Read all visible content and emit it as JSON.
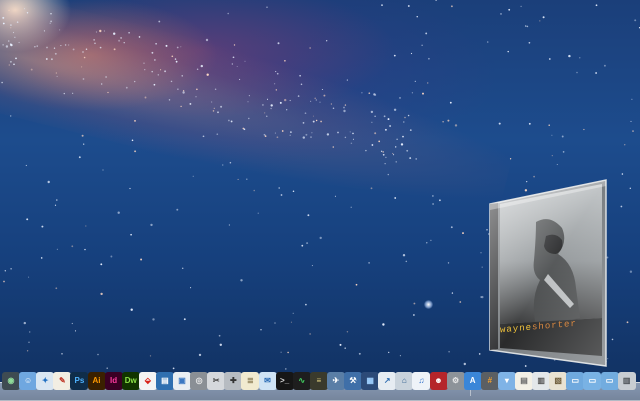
{
  "desktop": {
    "wallpaper": "Andromeda galaxy",
    "colors": {
      "sky": "#1d4c8d",
      "galaxy_core": "#ffe8cf",
      "accent": "#f0c23a"
    }
  },
  "cd_cover": {
    "artist_first": "wayne",
    "artist_last": "shorter"
  },
  "dock": {
    "items": [
      {
        "name": "time-machine-icon",
        "glyph": "◉",
        "bg": "#3e4b52",
        "fg": "#8fdc9a"
      },
      {
        "name": "finder-icon",
        "glyph": "☺",
        "bg": "#6fa7e0",
        "fg": "#ffffff"
      },
      {
        "name": "safari-icon",
        "glyph": "✦",
        "bg": "#d9e6f2",
        "fg": "#1f6fc2"
      },
      {
        "name": "textedit-icon",
        "glyph": "✎",
        "bg": "#f2eee3",
        "fg": "#c0392b"
      },
      {
        "name": "photoshop-icon",
        "glyph": "Ps",
        "bg": "#0f2d4a",
        "fg": "#4fb3ff"
      },
      {
        "name": "illustrator-icon",
        "glyph": "Ai",
        "bg": "#3a2000",
        "fg": "#ff9a00"
      },
      {
        "name": "indesign-icon",
        "glyph": "Id",
        "bg": "#3a0024",
        "fg": "#ff3ba0"
      },
      {
        "name": "dreamweaver-icon",
        "glyph": "Dw",
        "bg": "#113400",
        "fg": "#8de348"
      },
      {
        "name": "acrobat-icon",
        "glyph": "⬙",
        "bg": "#f4f4f4",
        "fg": "#d8231a"
      },
      {
        "name": "keynote-icon",
        "glyph": "▤",
        "bg": "#2f6fb0",
        "fg": "#ffffff"
      },
      {
        "name": "preview-icon",
        "glyph": "▣",
        "bg": "#e9eef2",
        "fg": "#3b78c2"
      },
      {
        "name": "dvd-player-icon",
        "glyph": "◎",
        "bg": "#8a8f95",
        "fg": "#e8e8e8"
      },
      {
        "name": "script-editor-icon",
        "glyph": "✂",
        "bg": "#d5d8dc",
        "fg": "#444444"
      },
      {
        "name": "disk-utility-icon",
        "glyph": "✚",
        "bg": "#b7bcc2",
        "fg": "#333333"
      },
      {
        "name": "notes-icon",
        "glyph": "≣",
        "bg": "#f1ead0",
        "fg": "#7a6a40"
      },
      {
        "name": "mail-icon",
        "glyph": "✉",
        "bg": "#cfe3f5",
        "fg": "#2a6bb5"
      },
      {
        "name": "terminal-icon",
        "glyph": ">_",
        "bg": "#161616",
        "fg": "#dcdcdc"
      },
      {
        "name": "activity-monitor-icon",
        "glyph": "∿",
        "bg": "#1e1e1e",
        "fg": "#40d060"
      },
      {
        "name": "console-icon",
        "glyph": "≡",
        "bg": "#3a3a2c",
        "fg": "#e0d080"
      },
      {
        "name": "automator-icon",
        "glyph": "✈",
        "bg": "#5a7ea6",
        "fg": "#ffffff"
      },
      {
        "name": "xcode-icon",
        "glyph": "⚒",
        "bg": "#3f6fa8",
        "fg": "#ffffff"
      },
      {
        "name": "image-capture-icon",
        "glyph": "▦",
        "bg": "#2c4a78",
        "fg": "#9fd0ff"
      },
      {
        "name": "grapher-icon",
        "glyph": "↗",
        "bg": "#e6ecf2",
        "fg": "#2c6bb0"
      },
      {
        "name": "network-utility-icon",
        "glyph": "⌂",
        "bg": "#c9d3dc",
        "fg": "#2a5a8a"
      },
      {
        "name": "itunes-icon",
        "glyph": "♫",
        "bg": "#eef3f8",
        "fg": "#2e6fc9"
      },
      {
        "name": "photo-booth-icon",
        "glyph": "☻",
        "bg": "#b5252a",
        "fg": "#ffffff"
      },
      {
        "name": "system-preferences-icon",
        "glyph": "⚙",
        "bg": "#8d9399",
        "fg": "#e8e8e8"
      },
      {
        "name": "app-store-icon",
        "glyph": "A",
        "bg": "#3a86d8",
        "fg": "#ffffff"
      },
      {
        "name": "calculator-icon",
        "glyph": "#",
        "bg": "#5b5f63",
        "fg": "#f0a030"
      },
      {
        "name": "downloads-stack-icon",
        "glyph": "▾",
        "bg": "#7fb3e6",
        "fg": "#ffffff"
      },
      {
        "name": "documents-stack-icon",
        "glyph": "▤",
        "bg": "#f3f0e6",
        "fg": "#6a6a6a"
      },
      {
        "name": "applications-stack-icon",
        "glyph": "▥",
        "bg": "#e3e7ea",
        "fg": "#555555"
      },
      {
        "name": "pictures-stack-icon",
        "glyph": "▧",
        "bg": "#e8e2d2",
        "fg": "#6d5c3a"
      },
      {
        "name": "documents-folder-icon",
        "glyph": "▭",
        "bg": "#6fa9de",
        "fg": "#ffffff"
      },
      {
        "name": "shared-folder-icon",
        "glyph": "▭",
        "bg": "#79b2e4",
        "fg": "#ffffff"
      },
      {
        "name": "home-folder-icon",
        "glyph": "▭",
        "bg": "#72acdf",
        "fg": "#ffffff"
      },
      {
        "name": "trash-icon",
        "glyph": "▥",
        "bg": "#c8cdd2",
        "fg": "#4b5055"
      }
    ]
  }
}
